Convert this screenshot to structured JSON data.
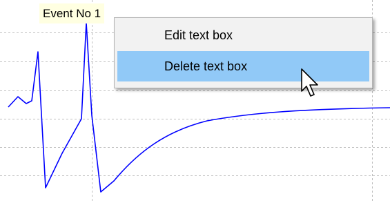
{
  "event_label": {
    "text": "Event No 1"
  },
  "context_menu": {
    "items": [
      {
        "label": "Edit text box",
        "highlighted": false
      },
      {
        "label": "Delete text box",
        "highlighted": true
      }
    ]
  },
  "colors": {
    "trace": "#0000ff",
    "gridline": "#bfbfbf",
    "label_background": "#ffffe1",
    "menu_background": "#f2f2f2",
    "menu_highlight": "#91c9f7"
  },
  "icons": {
    "cursor": "arrow-cursor-icon"
  }
}
